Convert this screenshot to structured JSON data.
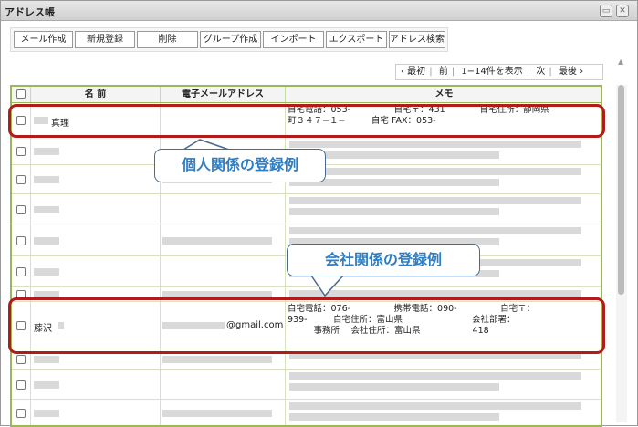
{
  "window": {
    "title": "アドレス帳",
    "minimize_icon": "minimize-icon",
    "close_icon": "close-icon"
  },
  "toolbar": [
    "メール作成",
    "新規登録",
    "削除",
    "グループ作成",
    "インポート",
    "エクスポート",
    "アドレス検索"
  ],
  "pager": {
    "first": "‹ 最初",
    "prev": "前",
    "range": "1−14件を表示",
    "next": "次",
    "last": "最後 ›"
  },
  "table": {
    "headers": {
      "name": "名 前",
      "email": "電子メールアドレス",
      "memo": "メモ"
    },
    "row1": {
      "name": "真理",
      "memo_line1": "自宅電話：053-　　　　　自宅〒：431　　　　自宅住所：静岡県",
      "memo_line2": "町３４７−１−　　　自宅 FAX：053-"
    },
    "row8": {
      "name": "藤沢",
      "email": "@gmail.com",
      "memo_line1": "自宅電話：076-　　　　　携帯電話：090-　　　　　自宅〒：",
      "memo_line2": "939-　　　自宅住所：富山県　　　　　　　　会社部署：",
      "memo_line3": "　　　事務所　 会社住所：富山県　　　　　　418"
    }
  },
  "callouts": {
    "personal": "個人関係の登録例",
    "company": "会社関係の登録例"
  },
  "colors": {
    "highlight": "#b11b1b",
    "callout_text": "#2e7ec4",
    "table_border": "#9ab85a"
  }
}
